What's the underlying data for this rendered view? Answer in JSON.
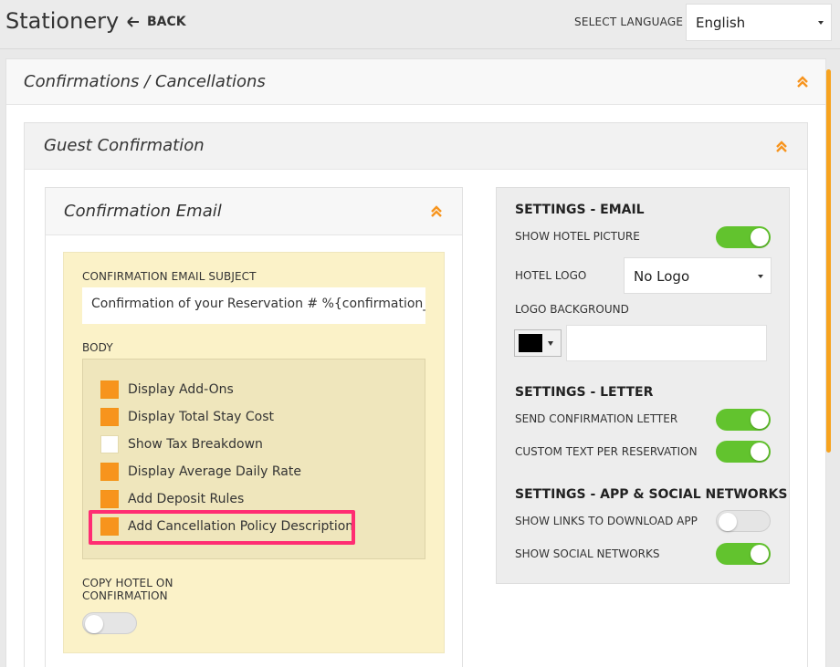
{
  "header": {
    "title": "Stationery",
    "back_label": "BACK",
    "language_label": "SELECT LANGUAGE",
    "language_value": "English"
  },
  "sections": {
    "outer_title": "Confirmations / Cancellations",
    "guest_title": "Guest Confirmation",
    "email_title": "Confirmation Email"
  },
  "email_form": {
    "subject_label": "CONFIRMATION EMAIL SUBJECT",
    "subject_value": "Confirmation of your  Reservation # %{confirmation_n",
    "body_label": "BODY",
    "options": [
      {
        "label": "Display Add-Ons",
        "checked": true
      },
      {
        "label": "Display Total Stay Cost",
        "checked": true
      },
      {
        "label": "Show Tax Breakdown",
        "checked": false
      },
      {
        "label": "Display Average Daily Rate",
        "checked": true
      },
      {
        "label": "Add Deposit Rules",
        "checked": true
      },
      {
        "label": "Add Cancellation Policy Description",
        "checked": true
      }
    ],
    "copy_hotel_label_line1": "COPY HOTEL ON",
    "copy_hotel_label_line2": "CONFIRMATION",
    "copy_hotel_on": false
  },
  "settings": {
    "email_heading": "SETTINGS - EMAIL",
    "show_hotel_picture_label": "SHOW HOTEL PICTURE",
    "show_hotel_picture_on": true,
    "hotel_logo_label": "HOTEL LOGO",
    "hotel_logo_value": "No Logo",
    "logo_background_label": "LOGO BACKGROUND",
    "logo_background_color": "#000000",
    "letter_heading": "SETTINGS - LETTER",
    "send_confirmation_letter_label": "SEND CONFIRMATION LETTER",
    "send_confirmation_letter_on": true,
    "custom_text_label": "CUSTOM TEXT PER RESERVATION",
    "custom_text_on": true,
    "app_heading": "SETTINGS - APP & SOCIAL NETWORKS",
    "show_links_label": "SHOW LINKS TO DOWNLOAD APP",
    "show_links_on": false,
    "show_social_label": "SHOW SOCIAL NETWORKS",
    "show_social_on": true
  },
  "colors": {
    "accent_orange": "#f7941d",
    "toggle_on": "#62c32e",
    "highlight": "#ff2d72",
    "form_background": "#fbf2c8"
  }
}
